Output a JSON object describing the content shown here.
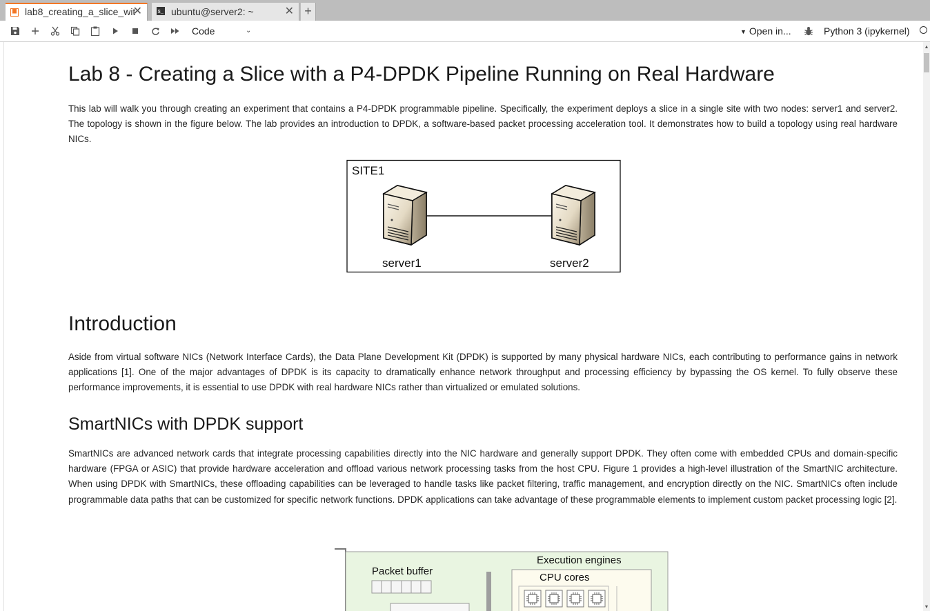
{
  "tabs": [
    {
      "label": "lab8_creating_a_slice_wit",
      "icon": "notebook-icon",
      "active": true
    },
    {
      "label": "ubuntu@server2: ~",
      "icon": "terminal-icon",
      "active": false
    }
  ],
  "tab_add_label": "+",
  "tab_close_glyph": "✕",
  "toolbar": {
    "cell_type": "Code",
    "open_in": "Open in...",
    "kernel": "Python 3 (ipykernel)",
    "icons": [
      "save-icon",
      "add-cell-icon",
      "cut-icon",
      "copy-icon",
      "paste-icon",
      "run-icon",
      "stop-icon",
      "restart-icon",
      "fast-forward-icon"
    ]
  },
  "notebook": {
    "title": "Lab 8 - Creating a Slice with a P4-DPDK Pipeline Running on Real Hardware",
    "intro_paragraph": "This lab will walk you through creating an experiment that contains a P4-DPDK programmable pipeline. Specifically, the experiment deploys a slice in a single site with two nodes: server1 and server2. The topology is shown in the figure below. The lab provides an introduction to DPDK, a software-based packet processing acceleration tool. It demonstrates how to build a topology using real hardware NICs.",
    "topology_figure": {
      "site_label": "SITE1",
      "node1_label": "server1",
      "node2_label": "server2"
    },
    "introduction_heading": "Introduction",
    "introduction_paragraph": "Aside from virtual software NICs (Network Interface Cards), the Data Plane Development Kit (DPDK) is supported by many physical hardware NICs, each contributing to performance gains in network applications [1]. One of the major advantages of DPDK is its capacity to dramatically enhance network throughput and processing efficiency by bypassing the OS kernel. To fully observe these performance improvements, it is essential to use DPDK with real hardware NICs rather than virtualized or emulated solutions.",
    "smartnic_heading": "SmartNICs with DPDK support",
    "smartnic_paragraph": "SmartNICs are advanced network cards that integrate processing capabilities directly into the NIC hardware and generally support DPDK. They often come with embedded CPUs and domain-specific hardware (FPGA or ASIC) that provide hardware acceleration and offload various network processing tasks from the host CPU. Figure 1 provides a high-level illustration of the SmartNIC architecture. When using DPDK with SmartNICs, these offloading capabilities can be leveraged to handle tasks like packet filtering, traffic management, and encryption directly on the NIC. SmartNICs often include programmable data paths that can be customized for specific network functions. DPDK applications can take advantage of these programmable elements to implement custom packet processing logic [2].",
    "smartnic_figure": {
      "packet_buffer_label": "Packet buffer",
      "execution_engines_label": "Execution engines",
      "cpu_cores_label": "CPU cores"
    }
  },
  "colors": {
    "tab_accent": "#f37726",
    "figure_green": "#e9f5e1",
    "figure_cream": "#fdfbee"
  }
}
